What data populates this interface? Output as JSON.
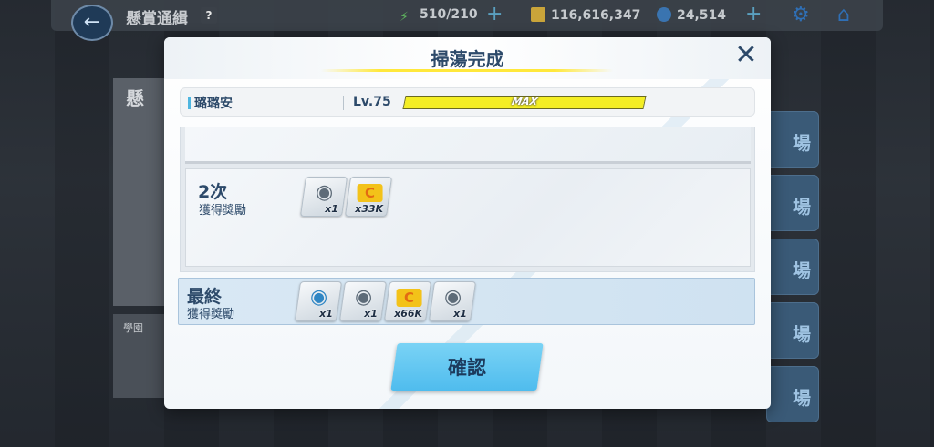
{
  "background": {
    "header_title": "懸賞通緝",
    "help_label": "?",
    "ap": "510/210",
    "credits": "116,616,347",
    "gems": "24,514",
    "side_label": "場",
    "left_title": "懸",
    "left_sub": "學園"
  },
  "modal": {
    "title": "掃蕩完成",
    "character": {
      "name": "璐璐安",
      "level": "Lv.75",
      "exp_label": "MAX",
      "exp_fraction": 1.0
    },
    "rounds": [
      {
        "count": "2次",
        "label": "獲得獎勵",
        "items": [
          {
            "icon": "disc-icon",
            "qty": "x1"
          },
          {
            "icon": "credit-icon",
            "qty": "x33K"
          }
        ]
      }
    ],
    "final": {
      "title": "最終",
      "label": "獲得獎勵",
      "items": [
        {
          "icon": "disc-blue-icon",
          "qty": "x1"
        },
        {
          "icon": "disc-icon",
          "qty": "x1"
        },
        {
          "icon": "credit-icon",
          "qty": "x66K"
        },
        {
          "icon": "disc-icon",
          "qty": "x1"
        }
      ]
    },
    "confirm_label": "確認"
  },
  "colors": {
    "accent": "#4fbcee",
    "title_text": "#2d4a6a",
    "exp_fill": "#f4ee24",
    "credit": "#f3c219"
  }
}
